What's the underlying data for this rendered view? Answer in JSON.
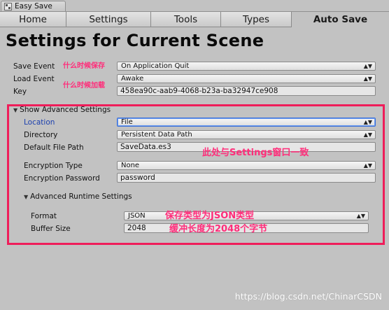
{
  "window": {
    "title": "Easy Save"
  },
  "tabs": [
    {
      "label": "Home",
      "active": false
    },
    {
      "label": "Settings",
      "active": false
    },
    {
      "label": "Tools",
      "active": false
    },
    {
      "label": "Types",
      "active": false
    },
    {
      "label": "Auto Save",
      "active": true
    }
  ],
  "page_title": "Settings for Current Scene",
  "fields": {
    "save_event": {
      "label": "Save Event",
      "value": "On Application Quit",
      "note": "什么时候保存"
    },
    "load_event": {
      "label": "Load Event",
      "value": "Awake",
      "note": "什么时候加载"
    },
    "key": {
      "label": "Key",
      "value": "458ea90c-aab9-4068-b23a-ba32947ce908"
    }
  },
  "advanced": {
    "foldout_label": "Show Advanced Settings",
    "location": {
      "label": "Location",
      "value": "File"
    },
    "directory": {
      "label": "Directory",
      "value": "Persistent Data Path"
    },
    "default_file_path": {
      "label": "Default File Path",
      "value": "SaveData.es3"
    },
    "encryption_type": {
      "label": "Encryption Type",
      "value": "None"
    },
    "encryption_password": {
      "label": "Encryption Password",
      "value": "password"
    },
    "runtime": {
      "foldout_label": "Advanced Runtime Settings",
      "format": {
        "label": "Format",
        "value": "JSON"
      },
      "buffer_size": {
        "label": "Buffer Size",
        "value": "2048"
      }
    },
    "note_same": "此处与Settings窗口一致",
    "note_format_1": "保存类型为JSON类型",
    "note_format_2": "缓冲长度为2048个字节"
  },
  "watermark": "https://blog.csdn.net/ChinarCSDN",
  "colors": {
    "annotation": "#ff2d7a",
    "highlight_box": "#ef1d5a",
    "link_label": "#1b3fae"
  }
}
